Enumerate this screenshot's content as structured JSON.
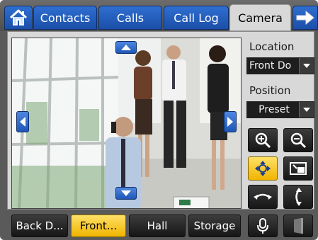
{
  "tabs": {
    "home_icon": "home-icon",
    "contacts": "Contacts",
    "calls": "Calls",
    "call_log": "Call Log",
    "camera": "Camera",
    "next_icon": "arrow-right-icon"
  },
  "camera": {
    "location_label": "Location",
    "location_value": "Front Do",
    "position_label": "Position",
    "position_value": "Preset"
  },
  "presets": {
    "back": "Back D...",
    "front": "Front...",
    "hall": "Hall",
    "storage": "Storage"
  },
  "colors": {
    "tab_blue": "#1b4fa8",
    "active_yellow": "#f0b400",
    "dark_button": "#161616"
  }
}
